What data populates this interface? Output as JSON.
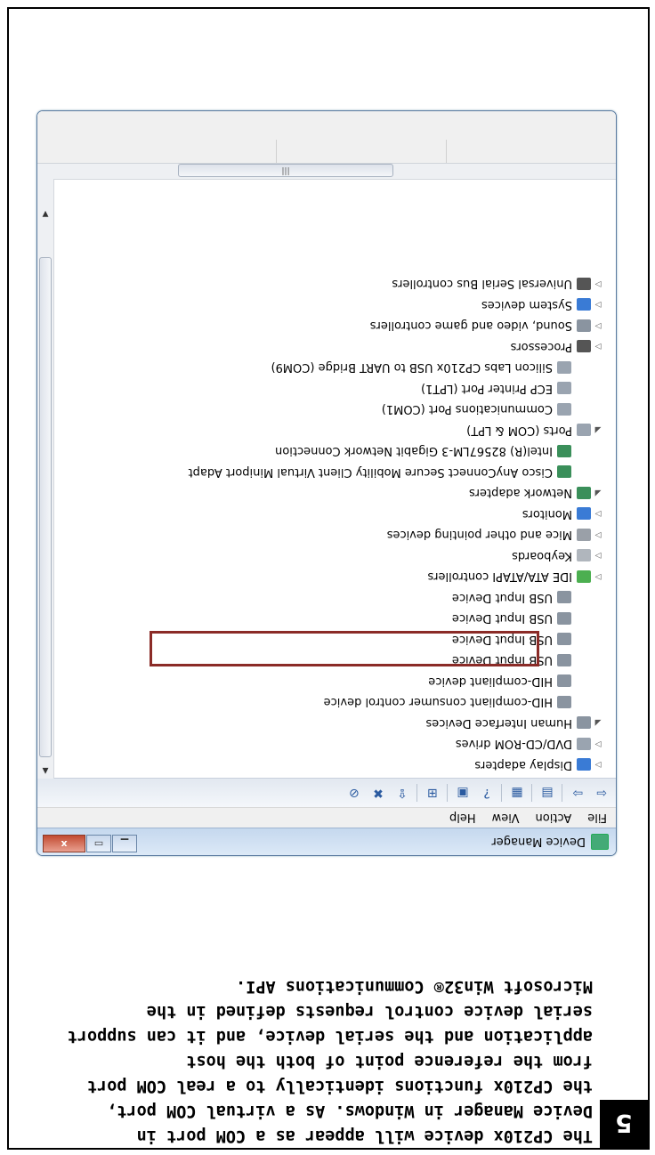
{
  "step": {
    "number": "5",
    "caption_lines": [
      "The CP210x device will appear as a COM port in",
      "Device Manager in Windows. As a virtual COM port,",
      "the CP210x functions identically to a real COM port",
      "from the reference point of both the host",
      "application and the serial device, and it can support",
      "serial device control requests defined in the",
      "Microsoft Win32® Communications API."
    ]
  },
  "window": {
    "title": "Device Manager",
    "menu": [
      "File",
      "Action",
      "View",
      "Help"
    ],
    "close_label": "x",
    "tree": [
      {
        "label": "Display adapters",
        "expand": "closed",
        "indent": 0,
        "icon_color": "#3a7bd5"
      },
      {
        "label": "DVD/CD-ROM drives",
        "expand": "closed",
        "indent": 0,
        "icon_color": "#9aa4b0"
      },
      {
        "label": "Human Interface Devices",
        "expand": "open",
        "indent": 0,
        "icon_color": "#8a94a0"
      },
      {
        "label": "HID-compliant consumer control device",
        "expand": "none",
        "indent": 1,
        "icon_color": "#8a94a0"
      },
      {
        "label": "HID-compliant device",
        "expand": "none",
        "indent": 1,
        "icon_color": "#8a94a0"
      },
      {
        "label": "USB Input Device",
        "expand": "none",
        "indent": 1,
        "icon_color": "#8a94a0"
      },
      {
        "label": "USB Input Device",
        "expand": "none",
        "indent": 1,
        "icon_color": "#8a94a0"
      },
      {
        "label": "USB Input Device",
        "expand": "none",
        "indent": 1,
        "icon_color": "#8a94a0"
      },
      {
        "label": "USB Input Device",
        "expand": "none",
        "indent": 1,
        "icon_color": "#8a94a0"
      },
      {
        "label": "IDE ATA/ATAPI controllers",
        "expand": "closed",
        "indent": 0,
        "icon_color": "#4caf50"
      },
      {
        "label": "Keyboards",
        "expand": "closed",
        "indent": 0,
        "icon_color": "#b0b6bd"
      },
      {
        "label": "Mice and other pointing devices",
        "expand": "closed",
        "indent": 0,
        "icon_color": "#9aa0a8"
      },
      {
        "label": "Monitors",
        "expand": "closed",
        "indent": 0,
        "icon_color": "#3a7bd5"
      },
      {
        "label": "Network adapters",
        "expand": "open",
        "indent": 0,
        "icon_color": "#3a8f5a"
      },
      {
        "label": "Cisco AnyConnect Secure Mobility Client Virtual Miniport Adapt",
        "expand": "none",
        "indent": 1,
        "icon_color": "#3a8f5a"
      },
      {
        "label": "Intel(R) 82567LM-3 Gigabit Network Connection",
        "expand": "none",
        "indent": 1,
        "icon_color": "#3a8f5a"
      },
      {
        "label": "Ports (COM & LPT)",
        "expand": "open",
        "indent": 0,
        "icon_color": "#9aa4b0"
      },
      {
        "label": "Communications Port (COM1)",
        "expand": "none",
        "indent": 1,
        "icon_color": "#9aa4b0"
      },
      {
        "label": "ECP Printer Port (LPT1)",
        "expand": "none",
        "indent": 1,
        "icon_color": "#9aa4b0"
      },
      {
        "label": "Silicon Labs CP210x USB to UART Bridge (COM9)",
        "expand": "none",
        "indent": 1,
        "icon_color": "#9aa4b0"
      },
      {
        "label": "Processors",
        "expand": "closed",
        "indent": 0,
        "icon_color": "#555555"
      },
      {
        "label": "Sound, video and game controllers",
        "expand": "closed",
        "indent": 0,
        "icon_color": "#8a94a0"
      },
      {
        "label": "System devices",
        "expand": "closed",
        "indent": 0,
        "icon_color": "#3a7bd5"
      },
      {
        "label": "Universal Serial Bus controllers",
        "expand": "closed",
        "indent": 0,
        "icon_color": "#555555"
      }
    ],
    "highlighted_item": "Silicon Labs CP210x USB to UART Bridge (COM9)",
    "highlight_color": "#8b2b27"
  }
}
